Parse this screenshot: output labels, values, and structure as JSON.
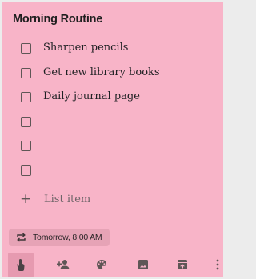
{
  "note": {
    "title": "Morning Routine",
    "items": [
      {
        "text": "Sharpen pencils",
        "checked": false
      },
      {
        "text": "Get new library books",
        "checked": false
      },
      {
        "text": "Daily journal page",
        "checked": false
      },
      {
        "text": "",
        "checked": false
      },
      {
        "text": "",
        "checked": false
      },
      {
        "text": "",
        "checked": false
      }
    ],
    "add_item_label": "List item",
    "reminder": "Tomorrow, 8:00 AM"
  },
  "colors": {
    "card_background": "#f8b4c8",
    "chip_background": "#e6a3b6",
    "active_tool_background": "#e69ab0",
    "icon": "#5f5656"
  },
  "toolbar": {
    "icons": [
      "remind-me-icon",
      "collaborator-icon",
      "palette-icon",
      "image-icon",
      "archive-icon",
      "more-icon"
    ]
  }
}
